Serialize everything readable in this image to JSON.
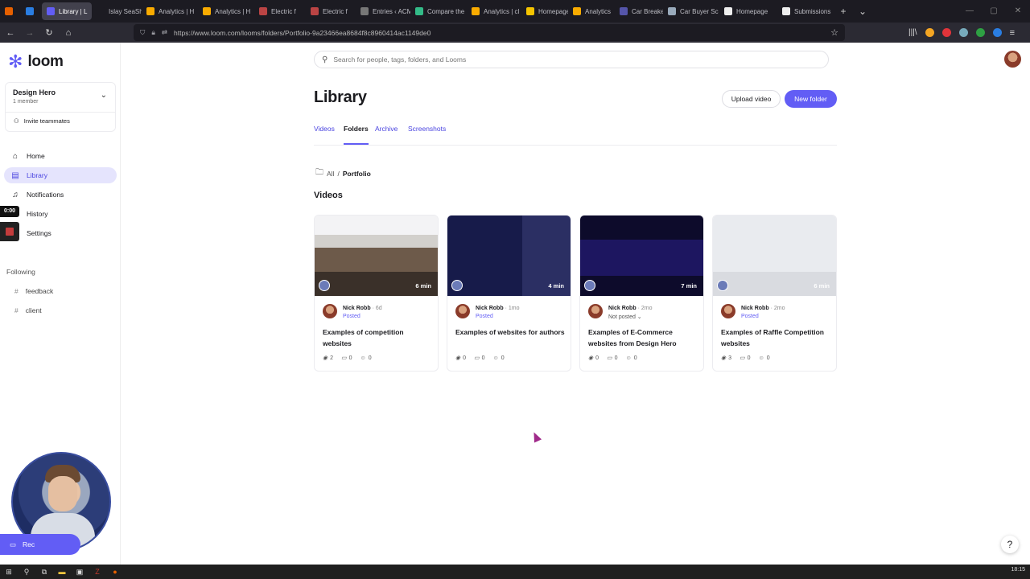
{
  "browser": {
    "tabs": [
      {
        "label": "",
        "color": "#e66000"
      },
      {
        "label": "",
        "color": "#2a7de1"
      },
      {
        "label": "Library | L",
        "color": "#625df5",
        "active": true
      },
      {
        "label": "Islay SeaShore",
        "color": "#1c1b22"
      },
      {
        "label": "Analytics | H",
        "color": "#f9ab00"
      },
      {
        "label": "Analytics | H",
        "color": "#f9ab00"
      },
      {
        "label": "Electric f",
        "color": "#b44"
      },
      {
        "label": "Electric f",
        "color": "#b44"
      },
      {
        "label": "Entries ‹ ACM",
        "color": "#777"
      },
      {
        "label": "Compare the",
        "color": "#3b8"
      },
      {
        "label": "Analytics | cl",
        "color": "#f9ab00"
      },
      {
        "label": "Homepage",
        "color": "#f5c400"
      },
      {
        "label": "Analytics",
        "color": "#f9ab00"
      },
      {
        "label": "Car Breakers",
        "color": "#55a"
      },
      {
        "label": "Car Buyer Sc",
        "color": "#9ab"
      },
      {
        "label": "Homepage",
        "color": "#eee"
      },
      {
        "label": "Submissions",
        "color": "#eee"
      }
    ],
    "url": "https://www.loom.com/looms/folders/Portfolio-9a23466ea8684f8c8960414ac1149de0",
    "clock": "18:15"
  },
  "sidebar": {
    "brand": "loom",
    "workspace": {
      "name": "Design Hero",
      "members": "1 member",
      "invite": "Invite teammates"
    },
    "nav": [
      {
        "label": "Home",
        "icon": "home-icon",
        "glyph": "⌂"
      },
      {
        "label": "Library",
        "icon": "library-icon",
        "glyph": "▤",
        "active": true
      },
      {
        "label": "Notifications",
        "icon": "bell-icon",
        "glyph": "♫"
      },
      {
        "label": "History",
        "icon": "history-icon",
        "glyph": "↺"
      },
      {
        "label": "Settings",
        "icon": "settings-icon",
        "glyph": "⚙"
      }
    ],
    "following_heading": "Following",
    "following": [
      "feedback",
      "client"
    ],
    "timer": "0:00",
    "record_label": "Rec"
  },
  "main": {
    "search_placeholder": "Search for people, tags, folders, and Looms",
    "title": "Library",
    "upload_label": "Upload video",
    "new_folder_label": "New folder",
    "tabs": [
      "Videos",
      "Folders",
      "Archive",
      "Screenshots"
    ],
    "active_tab": "Folders",
    "breadcrumb": {
      "root": "All",
      "sep": "/",
      "current": "Portfolio"
    },
    "section_heading": "Videos",
    "videos": [
      {
        "title": "Examples of competition websites",
        "author": "Nick Robb",
        "ago": "· 6d",
        "status": "Posted",
        "duration": "6 min",
        "views": "2",
        "comments": "0",
        "reactions": "0"
      },
      {
        "title": "Examples of websites for authors",
        "author": "Nick Robb",
        "ago": "· 1mo",
        "status": "Posted",
        "duration": "4 min",
        "views": "0",
        "comments": "0",
        "reactions": "0"
      },
      {
        "title": "Examples of E-Commerce websites from Design Hero",
        "author": "Nick Robb",
        "ago": "· 2mo",
        "status": "Not posted ⌄",
        "duration": "7 min",
        "views": "0",
        "comments": "0",
        "reactions": "0"
      },
      {
        "title": "Examples of Raffle Competition websites",
        "author": "Nick Robb",
        "ago": "· 2mo",
        "status": "Posted",
        "duration": "6 min",
        "views": "3",
        "comments": "0",
        "reactions": "0"
      }
    ],
    "help_label": "?"
  }
}
